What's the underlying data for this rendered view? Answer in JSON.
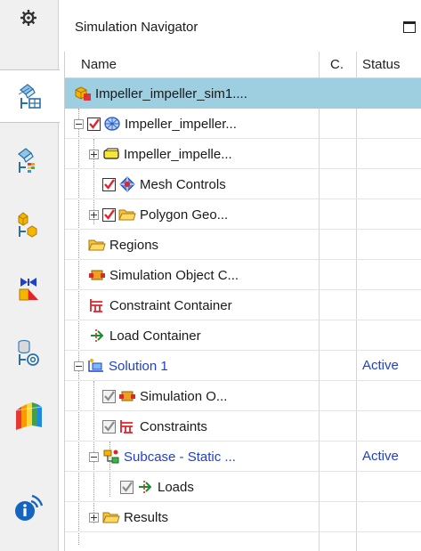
{
  "panel": {
    "title": "Simulation Navigator"
  },
  "columns": {
    "name": "Name",
    "c": "C.",
    "status": "Status"
  },
  "colors": {
    "selected_row": "#9dcfe1",
    "blue_text": "#1f3fd1"
  },
  "resource_bar": [
    {
      "name": "gear-icon"
    },
    {
      "name": "simulation-navigator-icon",
      "active": true
    },
    {
      "name": "simulation-file-view-icon"
    },
    {
      "name": "part-navigator-icon"
    },
    {
      "name": "assembly-navigator-icon"
    },
    {
      "name": "history-icon"
    },
    {
      "name": "palette-library-icon"
    },
    {
      "name": "role-info-icon"
    }
  ],
  "tree": [
    {
      "label": "Impeller_impeller_sim1....",
      "status": "",
      "icon": "sim-file-icon"
    },
    {
      "label": "Impeller_impeller...",
      "status": "",
      "icon": "fem-icon"
    },
    {
      "label": "Impeller_impelle...",
      "status": "",
      "icon": "geometry-body-icon"
    },
    {
      "label": "Mesh Controls",
      "status": "",
      "icon": "mesh-controls-icon"
    },
    {
      "label": "Polygon Geo...",
      "status": "",
      "icon": "folder-icon"
    },
    {
      "label": "Regions",
      "status": "",
      "icon": "folder-icon"
    },
    {
      "label": "Simulation Object C...",
      "status": "",
      "icon": "simulation-object-icon"
    },
    {
      "label": "Constraint Container",
      "status": "",
      "icon": "constraint-icon"
    },
    {
      "label": "Load Container",
      "status": "",
      "icon": "load-icon"
    },
    {
      "label": "Solution 1",
      "status": "Active",
      "icon": "solution-icon"
    },
    {
      "label": "Simulation O...",
      "status": "",
      "icon": "simulation-object-icon"
    },
    {
      "label": "Constraints",
      "status": "",
      "icon": "constraint-icon"
    },
    {
      "label": "Subcase - Static ...",
      "status": "Active",
      "icon": "subcase-icon"
    },
    {
      "label": "Loads",
      "status": "",
      "icon": "load-icon"
    },
    {
      "label": "Results",
      "status": "",
      "icon": "folder-icon"
    }
  ]
}
